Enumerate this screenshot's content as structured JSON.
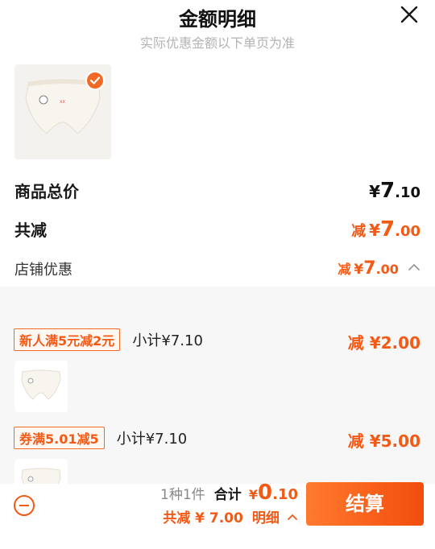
{
  "header": {
    "title": "金额明细",
    "subtitle": "实际优惠金额以下单页为准"
  },
  "summary_rows": {
    "total_label": "商品总价",
    "total_currency": "¥",
    "total_int": "7",
    "total_dec": ".10",
    "reduce_label": "共减",
    "reduce_prefix": "减",
    "reduce_currency": "¥",
    "reduce_int": "7",
    "reduce_dec": ".00",
    "store_label": "店铺优惠",
    "store_prefix": "减",
    "store_currency": "¥",
    "store_int": "7",
    "store_dec": ".00"
  },
  "promos": [
    {
      "tag": "新人满5元减2元",
      "subtotal": "小计¥7.10",
      "amount": "减 ¥2.00"
    },
    {
      "tag": "券满5.01减5",
      "subtotal": "小计¥7.10",
      "amount": "减 ¥5.00"
    }
  ],
  "footer": {
    "count_text": "1种1件",
    "sum_label": "合计",
    "sum_currency": "¥",
    "sum_int": "0",
    "sum_dec": ".10",
    "reduce_text": "共减 ¥ 7.00",
    "detail_label": "明细",
    "checkout_label": "结算"
  },
  "colors": {
    "accent": "#f25a16",
    "checkout_bg": "#f24d0c"
  }
}
